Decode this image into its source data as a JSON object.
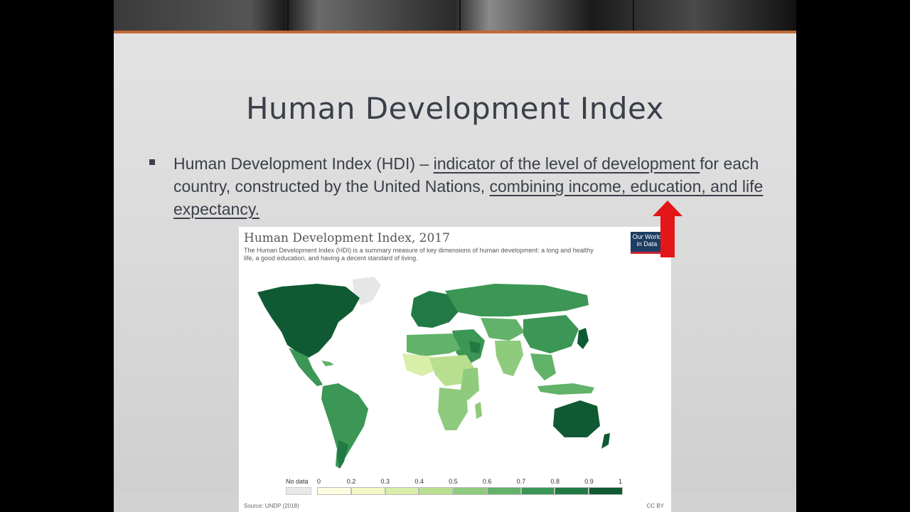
{
  "slide": {
    "title": "Human Development Index",
    "bullet": {
      "part1": "Human Development Index (HDI) – ",
      "part2_underlined": "indicator of the level of development ",
      "part3": "for each country, constructed by the United Nations, ",
      "part4_underlined": "combining income, education, and life expectancy."
    }
  },
  "map": {
    "title": "Human Development Index, 2017",
    "description": "The Human Development Index (HDI) is a summary measure of key dimensions of human development: a long and healthy life, a good education, and having a decent standard of living.",
    "logo_line1": "Our World",
    "logo_line2": "in Data",
    "legend": {
      "no_data_label": "No data",
      "ticks": [
        "0",
        "0.2",
        "0.3",
        "0.4",
        "0.5",
        "0.6",
        "0.7",
        "0.8",
        "0.9",
        "1"
      ],
      "colors": [
        "#fffde0",
        "#f3f7c5",
        "#d9eea8",
        "#b8df90",
        "#8fcb7c",
        "#62b26a",
        "#3c9655",
        "#217a43",
        "#0f5a32"
      ]
    },
    "source": "Source: UNDP (2018)",
    "license": "CC BY"
  },
  "colors": {
    "accent_bar": "#c0683a",
    "arrow": "#e3161a",
    "text": "#3b3f4a"
  }
}
